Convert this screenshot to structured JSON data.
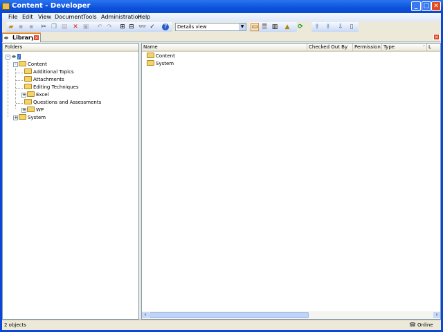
{
  "window": {
    "title": "Content - Developer",
    "minimize": "_",
    "maximize": "□",
    "close": "✕"
  },
  "menu": [
    "File",
    "Edit",
    "View",
    "Document",
    "Tools",
    "Administration",
    "Help"
  ],
  "toolbar": {
    "view_select": "Details view",
    "icons": [
      "open-icon",
      "save-icon",
      "save-all-icon",
      "cut-icon",
      "copy-icon",
      "paste-icon",
      "delete-icon",
      "properties-icon",
      "undo-icon",
      "redo-icon",
      "expand-icon",
      "collapse-icon",
      "find-icon",
      "spellcheck-icon",
      "help-icon",
      "details-view-icon",
      "horizontal-split-icon",
      "vertical-split-icon",
      "publish-icon",
      "refresh-icon",
      "check-in-icon",
      "check-out-icon",
      "import-icon",
      "export-icon"
    ]
  },
  "tab": {
    "label": "Library"
  },
  "folders": {
    "header": "Folders",
    "root": "/",
    "items": [
      {
        "label": "Content",
        "level": 1,
        "expander": "-"
      },
      {
        "label": "Additional Topics",
        "level": 2,
        "expander": ""
      },
      {
        "label": "Attachments",
        "level": 2,
        "expander": ""
      },
      {
        "label": "Editing Techniques",
        "level": 2,
        "expander": ""
      },
      {
        "label": "Excel",
        "level": 2,
        "expander": "+"
      },
      {
        "label": "Questions and Assessments",
        "level": 2,
        "expander": ""
      },
      {
        "label": "WP",
        "level": 2,
        "expander": "+"
      },
      {
        "label": "System",
        "level": 1,
        "expander": "+"
      }
    ]
  },
  "list": {
    "columns": [
      "Name",
      "Checked Out By",
      "Permission",
      "Type",
      "L"
    ],
    "sort_indicator": "^",
    "rows": [
      "Content",
      "System"
    ]
  },
  "status": {
    "count": "2 objects",
    "connection": "Online"
  }
}
